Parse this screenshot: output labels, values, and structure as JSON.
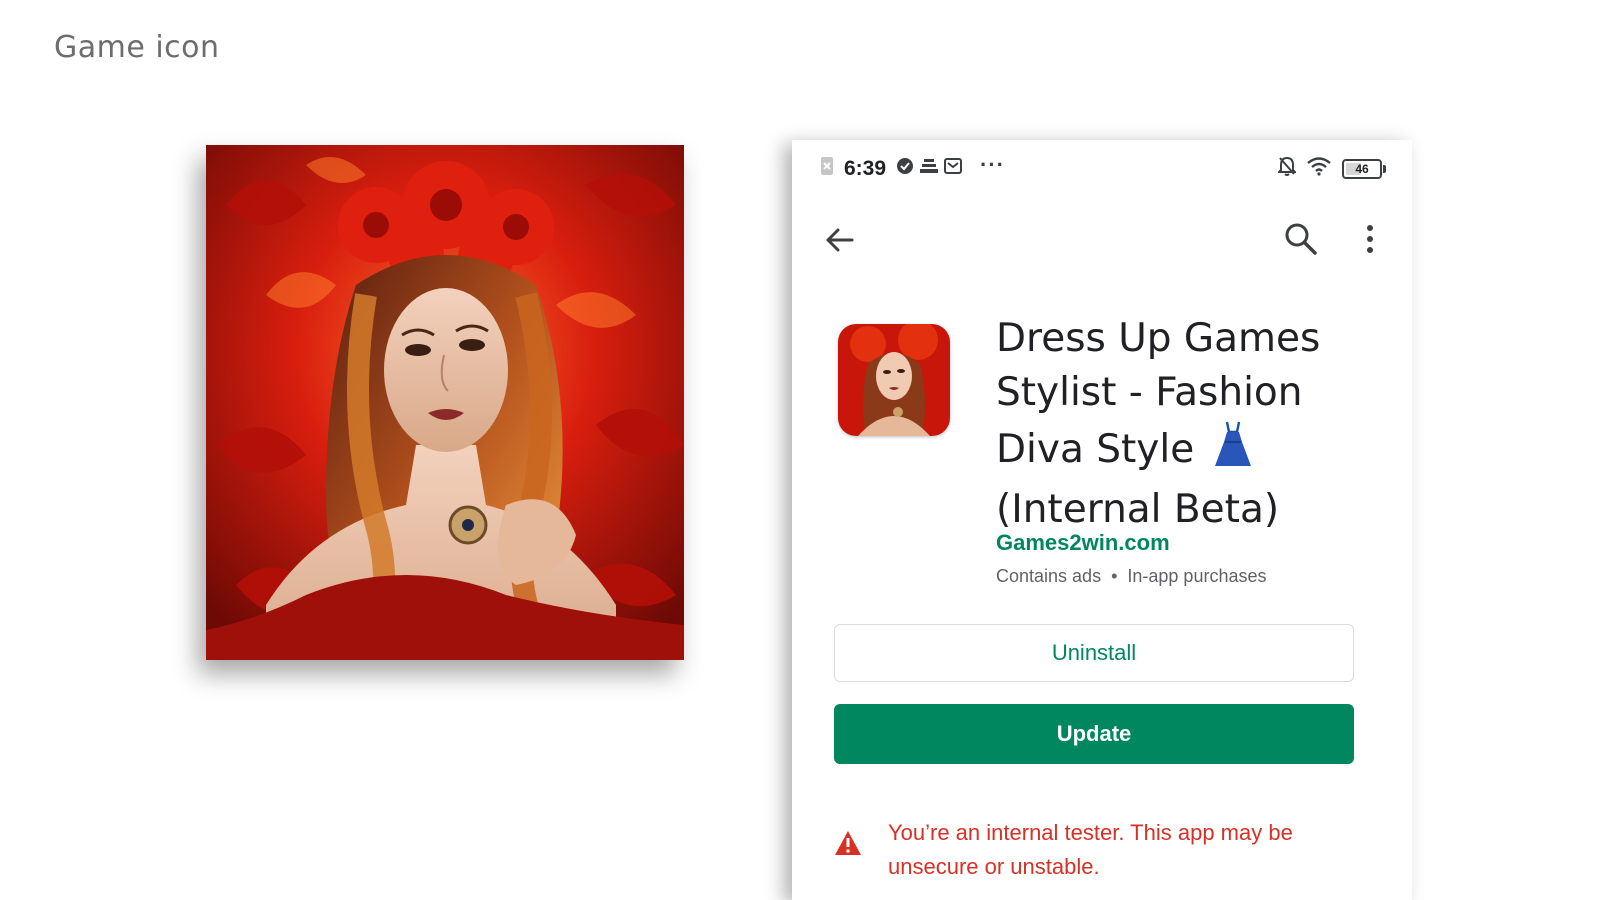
{
  "slide": {
    "title": "Game icon"
  },
  "artwork": {
    "icon_name": "game-artwork-woman-red-leaves"
  },
  "statusbar": {
    "time": "6:39",
    "battery": "46",
    "battery_level": 0.46,
    "left_icons": [
      "sim-off-icon",
      "check-circle-icon",
      "stack-icon",
      "mail-icon"
    ],
    "right_icons": [
      "bell-off-icon",
      "wifi-icon",
      "battery-icon"
    ]
  },
  "appbar": {
    "icons": [
      "back-arrow-icon",
      "search-icon",
      "more-vert-icon"
    ]
  },
  "app": {
    "title": "Dress Up Games Stylist - Fashion Diva Style",
    "title_suffix": "(Internal Beta)",
    "developer": "Games2win.com",
    "contains_ads": "Contains ads",
    "separator": "•",
    "in_app": "In-app purchases"
  },
  "buttons": {
    "uninstall": "Uninstall",
    "update": "Update"
  },
  "warning": {
    "text": "You’re an internal tester. This app may be unsecure or unstable."
  },
  "colors": {
    "accent": "#01875f",
    "warning": "#d93025",
    "text": "#202124",
    "muted": "#5f6368"
  }
}
